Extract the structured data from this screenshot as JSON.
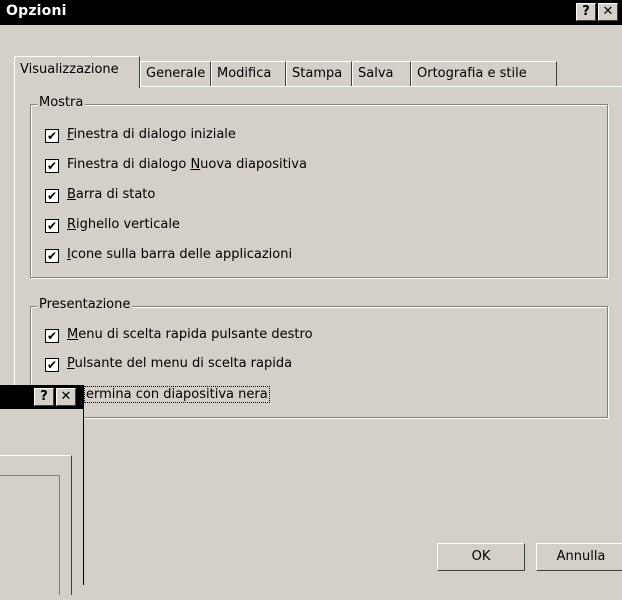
{
  "window": {
    "title": "Opzioni",
    "help_label": "?",
    "close_label": "✕"
  },
  "tabs": [
    {
      "label": "Visualizzazione",
      "active": true
    },
    {
      "label": "Generale"
    },
    {
      "label": "Modifica"
    },
    {
      "label": "Stampa"
    },
    {
      "label": "Salva"
    },
    {
      "label": "Ortografia e stile"
    }
  ],
  "show_group": {
    "title": "Mostra",
    "items": [
      {
        "pre": "",
        "mnemonic": "F",
        "post": "inestra di dialogo iniziale",
        "checked": true
      },
      {
        "pre": "Finestra di dialogo ",
        "mnemonic": "N",
        "post": "uova diapositiva",
        "checked": true
      },
      {
        "pre": "",
        "mnemonic": "B",
        "post": "arra di stato",
        "checked": true
      },
      {
        "pre": "",
        "mnemonic": "R",
        "post": "ighello verticale",
        "checked": true
      },
      {
        "pre": "",
        "mnemonic": "I",
        "post": "cone sulla barra delle applicazioni",
        "checked": true
      }
    ]
  },
  "presentation_group": {
    "title": "Presentazione",
    "items": [
      {
        "pre": "",
        "mnemonic": "M",
        "post": "enu di scelta rapida pulsante destro",
        "checked": true
      },
      {
        "pre": "",
        "mnemonic": "P",
        "post": "ulsante del menu di scelta rapida",
        "checked": true
      },
      {
        "pre": "",
        "mnemonic": "",
        "post": "ermina con diapositiva nera",
        "checked": false
      }
    ]
  },
  "buttons": {
    "ok": "OK",
    "cancel": "Annulla"
  },
  "second_window": {
    "help_label": "?",
    "close_label": "✕"
  },
  "check_glyph": "✔"
}
